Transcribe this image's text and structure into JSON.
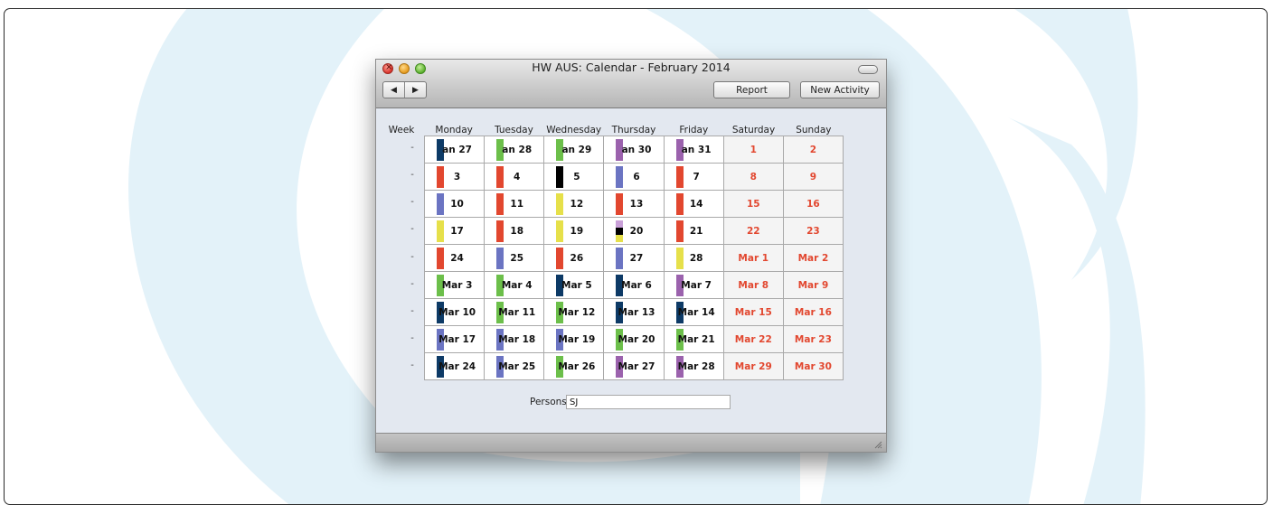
{
  "window": {
    "title": "HW AUS: Calendar - February 2014",
    "toolbar": {
      "prev_glyph": "◀",
      "next_glyph": "▶",
      "report_label": "Report",
      "new_activity_label": "New Activity"
    }
  },
  "calendar": {
    "week_header": "Week",
    "day_headers": [
      "Monday",
      "Tuesday",
      "Wednesday",
      "Thursday",
      "Friday",
      "Saturday",
      "Sunday"
    ],
    "weeks": [
      {
        "week": "-",
        "days": [
          "an 27",
          "an 28",
          "an 29",
          "an 30",
          "an 31",
          "1",
          "2"
        ]
      },
      {
        "week": "-",
        "days": [
          "3",
          "4",
          "5",
          "6",
          "7",
          "8",
          "9"
        ]
      },
      {
        "week": "-",
        "days": [
          "10",
          "11",
          "12",
          "13",
          "14",
          "15",
          "16"
        ]
      },
      {
        "week": "-",
        "days": [
          "17",
          "18",
          "19",
          "20",
          "21",
          "22",
          "23"
        ]
      },
      {
        "week": "-",
        "days": [
          "24",
          "25",
          "26",
          "27",
          "28",
          "Mar 1",
          "Mar 2"
        ]
      },
      {
        "week": "-",
        "days": [
          "Mar 3",
          "Mar 4",
          "Mar 5",
          "Mar 6",
          "Mar 7",
          "Mar 8",
          "Mar 9"
        ]
      },
      {
        "week": "-",
        "days": [
          "Mar 10",
          "Mar 11",
          "Mar 12",
          "Mar 13",
          "Mar 14",
          "Mar 15",
          "Mar 16"
        ]
      },
      {
        "week": "-",
        "days": [
          "Mar 17",
          "Mar 18",
          "Mar 19",
          "Mar 20",
          "Mar 21",
          "Mar 22",
          "Mar 23"
        ]
      },
      {
        "week": "-",
        "days": [
          "Mar 24",
          "Mar 25",
          "Mar 26",
          "Mar 27",
          "Mar 28",
          "Mar 29",
          "Mar 30"
        ]
      }
    ],
    "activity_colors": [
      [
        "#0d3a66",
        "#6cbf4a",
        "#6cbf4a",
        "#9b62ad",
        "#9b62ad"
      ],
      [
        "#e2472f",
        "#e2472f",
        "#000000",
        "#6b74c2",
        "#e2472f"
      ],
      [
        "#6b74c2",
        "#e2472f",
        "#e6e04a",
        "#e2472f",
        "#e2472f"
      ],
      [
        "#e6e04a",
        "#e2472f",
        "#e6e04a",
        [
          "#c9a0d8",
          "#000000",
          "#e6e04a"
        ],
        "#e2472f"
      ],
      [
        "#e2472f",
        "#6b74c2",
        "#e2472f",
        "#6b74c2",
        "#e6e04a"
      ],
      [
        "#6cbf4a",
        "#6cbf4a",
        "#0d3a66",
        "#0d3a66",
        "#9b62ad"
      ],
      [
        "#0d3a66",
        "#6cbf4a",
        "#6cbf4a",
        "#0d3a66",
        "#0d3a66"
      ],
      [
        "#6b74c2",
        "#6b74c2",
        "#6b74c2",
        "#6cbf4a",
        "#6cbf4a"
      ],
      [
        "#0d3a66",
        "#6b74c2",
        "#6cbf4a",
        "#9b62ad",
        "#9b62ad"
      ]
    ],
    "weekend_color": "#e2472f"
  },
  "persons": {
    "label": "Persons",
    "value": "SJ"
  }
}
